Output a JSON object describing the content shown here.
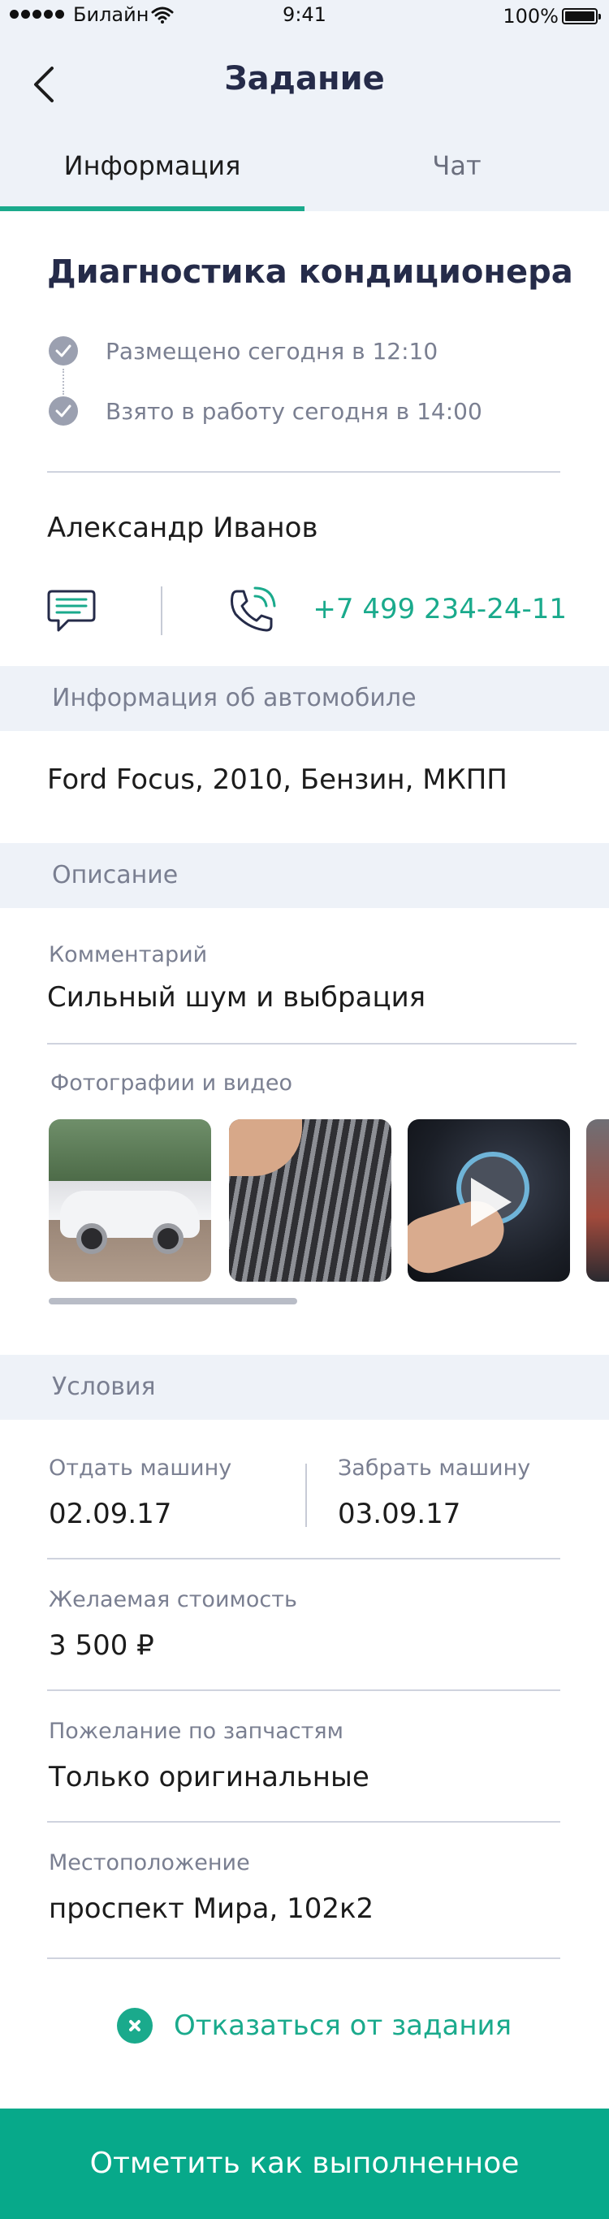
{
  "status_bar": {
    "carrier": "Билайн",
    "time": "9:41",
    "battery": "100%"
  },
  "nav": {
    "title": "Задание"
  },
  "tabs": [
    {
      "label": "Информация",
      "active": true
    },
    {
      "label": "Чат",
      "active": false
    }
  ],
  "task": {
    "title": "Диагностика кондиционера",
    "timeline": [
      {
        "label": "Размещено сегодня в 12:10"
      },
      {
        "label": "Взято в работу сегодня в 14:00"
      }
    ]
  },
  "contact": {
    "name": "Александр Иванов",
    "phone": "+7 499 234-24-11"
  },
  "car_section": {
    "header": "Информация об автомобиле",
    "value": "Ford Focus, 2010, Бензин, МКПП"
  },
  "description_section": {
    "header": "Описание",
    "comment_label": "Комментарий",
    "comment_value": "Сильный шум и выбрация",
    "media_label": "Фотографии и видео",
    "media": [
      {
        "icon": "car-photo"
      },
      {
        "icon": "filter-photo"
      },
      {
        "icon": "video-thumbnail"
      },
      {
        "icon": "photo"
      }
    ]
  },
  "conditions_section": {
    "header": "Условия",
    "dropoff_label": "Отдать машину",
    "dropoff_value": "02.09.17",
    "pickup_label": "Забрать машину",
    "pickup_value": "03.09.17",
    "price_label": "Желаемая стоимость",
    "price_value": "3 500 ₽",
    "parts_label": "Пожелание по запчастям",
    "parts_value": "Только оригинальные",
    "location_label": "Местоположение",
    "location_value": "проспект Мира, 102к2"
  },
  "actions": {
    "decline": "Отказаться от задания",
    "complete": "Отметить как выполненное"
  },
  "colors": {
    "accent": "#1aaa8c",
    "primary_button": "#07a98a",
    "header_bg": "#eef2f8",
    "title_text": "#252b49",
    "muted_text": "#7a7f91"
  }
}
